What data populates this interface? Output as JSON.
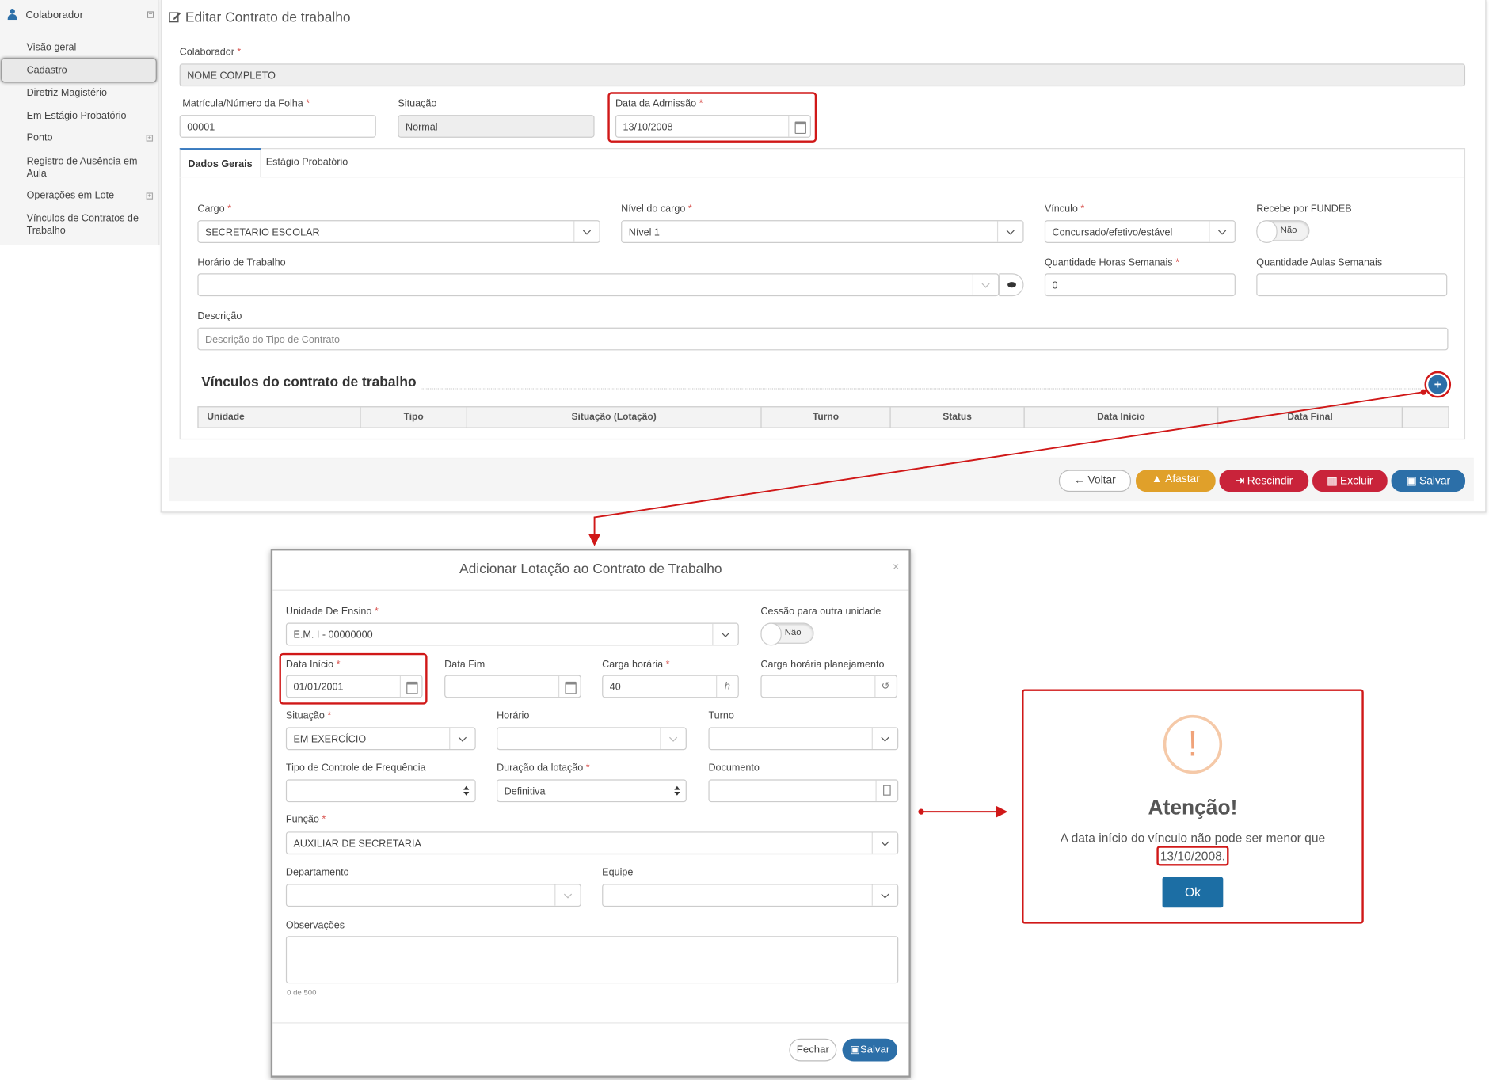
{
  "sidebar": {
    "header": "Colaborador",
    "items": [
      "Visão geral",
      "Cadastro",
      "Diretriz Magistério",
      "Em Estágio Probatório",
      "Ponto",
      "Registro de Ausência em Aula",
      "Operações em Lote",
      "Vínculos de Contratos de Trabalho"
    ]
  },
  "page": {
    "title": "Editar Contrato de trabalho",
    "colaborador_label": "Colaborador",
    "colaborador_value": "NOME COMPLETO",
    "matricula_label": "Matrícula/Número da Folha",
    "matricula_value": "00001",
    "situacao_label": "Situação",
    "situacao_value": "Normal",
    "admissao_label": "Data da Admissão",
    "admissao_value": "13/10/2008",
    "required_mark": "*"
  },
  "tabs": [
    "Dados Gerais",
    "Estágio Probatório"
  ],
  "form": {
    "cargo_label": "Cargo",
    "cargo_value": "SECRETARIO ESCOLAR",
    "nivel_label": "Nível do cargo",
    "nivel_value": "Nível 1",
    "vinculo_label": "Vínculo",
    "vinculo_value": "Concursado/efetivo/estável",
    "fundeb_label": "Recebe por FUNDEB",
    "fundeb_value": "Não",
    "horario_label": "Horário de Trabalho",
    "horario_value": "",
    "horas_label": "Quantidade Horas Semanais",
    "horas_value": "0",
    "aulas_label": "Quantidade Aulas Semanais",
    "aulas_value": "",
    "descricao_label": "Descrição",
    "descricao_placeholder": "Descrição do Tipo de Contrato"
  },
  "vinculos": {
    "title": "Vínculos do contrato de trabalho",
    "add_icon": "+",
    "columns": [
      "Unidade",
      "Tipo",
      "Situação (Lotação)",
      "Turno",
      "Status",
      "Data Início",
      "Data Final",
      ""
    ]
  },
  "footer_buttons": {
    "voltar": "Voltar",
    "afastar": "Afastar",
    "rescindir": "Rescindir",
    "excluir": "Excluir",
    "salvar": "Salvar"
  },
  "modal": {
    "title": "Adicionar Lotação ao Contrato de Trabalho",
    "close": "×",
    "unidade_label": "Unidade De Ensino",
    "unidade_value": "E.M. I - 00000000",
    "cessao_label": "Cessão para outra unidade",
    "cessao_value": "Não",
    "data_inicio_label": "Data Início",
    "data_inicio_value": "01/01/2001",
    "data_fim_label": "Data Fim",
    "data_fim_value": "",
    "carga_label": "Carga horária",
    "carga_value": "40",
    "carga_unit": "h",
    "carga_plan_label": "Carga horária planejamento",
    "carga_plan_value": "",
    "situacao_label": "Situação",
    "situacao_value": "EM EXERCÍCIO",
    "horario_label": "Horário",
    "turno_label": "Turno",
    "freq_label": "Tipo de Controle de Frequência",
    "freq_value": "",
    "duracao_label": "Duração da lotação",
    "duracao_value": "Definitiva",
    "documento_label": "Documento",
    "documento_value": "",
    "funcao_label": "Função",
    "funcao_value": "AUXILIAR DE SECRETARIA",
    "departamento_label": "Departamento",
    "equipe_label": "Equipe",
    "observacoes_label": "Observações",
    "observacoes_counter": "0 de 500",
    "fechar": "Fechar",
    "salvar": "Salvar"
  },
  "alert": {
    "icon": "!",
    "title": "Atenção!",
    "message": "A data início do vínculo não pode ser menor que",
    "date": "13/10/2008.",
    "ok": "Ok"
  },
  "colors": {
    "primary": "#2c6fa8",
    "danger": "#c9233a",
    "warning": "#e0a02a",
    "annotation": "#d01818"
  }
}
